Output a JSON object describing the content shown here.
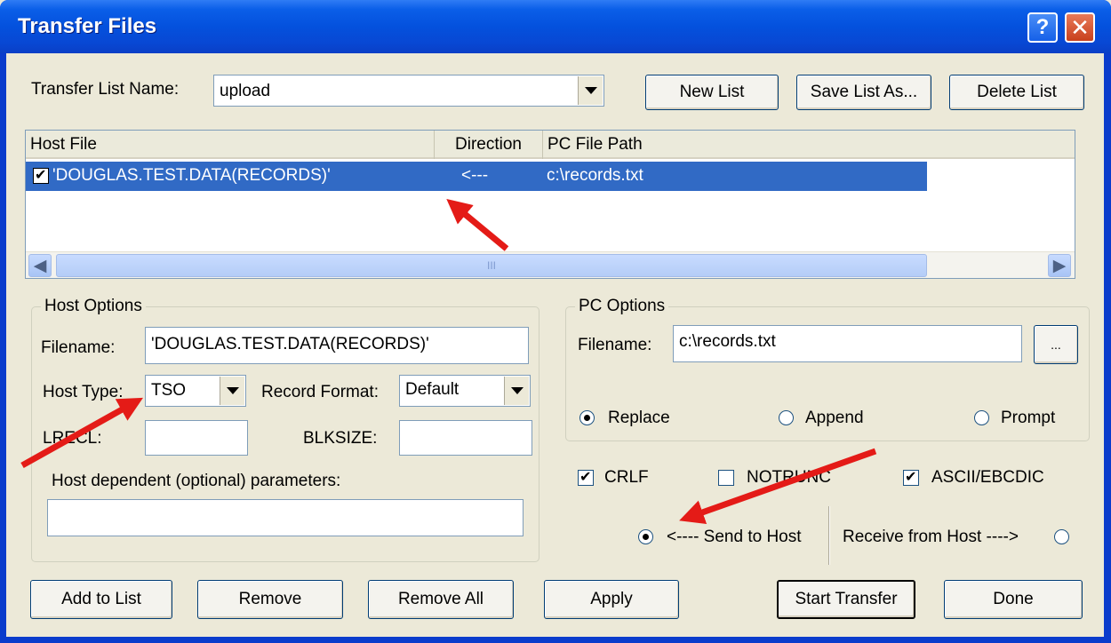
{
  "window": {
    "title": "Transfer Files",
    "help_glyph": "?",
    "close_glyph": "✕"
  },
  "transfer_list": {
    "label": "Transfer List Name:",
    "value": "upload",
    "new_list": "New List",
    "save_list_as": "Save List As...",
    "delete_list": "Delete List"
  },
  "file_list": {
    "columns": [
      "Host File",
      "Direction",
      "PC File Path"
    ],
    "rows": [
      {
        "checked": true,
        "host_file": "'DOUGLAS.TEST.DATA(RECORDS)'",
        "direction": "<---",
        "pc_path": "c:\\records.txt"
      }
    ],
    "scroll_thumb_grip": "III"
  },
  "host_options": {
    "title": "Host Options",
    "filename_label": "Filename:",
    "filename_value": "'DOUGLAS.TEST.DATA(RECORDS)'",
    "host_type_label": "Host Type:",
    "host_type_value": "TSO",
    "record_format_label": "Record Format:",
    "record_format_value": "Default",
    "lrecl_label": "LRECL:",
    "lrecl_value": "",
    "blksize_label": "BLKSIZE:",
    "blksize_value": "",
    "params_label": "Host dependent (optional) parameters:",
    "params_value": ""
  },
  "pc_options": {
    "title": "PC Options",
    "filename_label": "Filename:",
    "filename_value": "c:\\records.txt",
    "browse_label": "...",
    "replace": "Replace",
    "append": "Append",
    "prompt": "Prompt",
    "selected": "replace"
  },
  "flags": {
    "crlf": {
      "label": "CRLF",
      "checked": true
    },
    "notrunc": {
      "label": "NOTRUNC",
      "checked": false
    },
    "ascii": {
      "label": "ASCII/EBCDIC",
      "checked": true
    }
  },
  "direction": {
    "send": "<---- Send to Host",
    "receive": "Receive from Host ---->",
    "selected": "send"
  },
  "footer": {
    "add_to_list": "Add to List",
    "remove": "Remove",
    "remove_all": "Remove All",
    "apply": "Apply",
    "start_transfer": "Start Transfer",
    "done": "Done"
  },
  "colors": {
    "titlebar": "#0451dd",
    "dialog_bg": "#ece9d8",
    "selection": "#316ac5",
    "annotation_arrow": "#e41b17"
  }
}
